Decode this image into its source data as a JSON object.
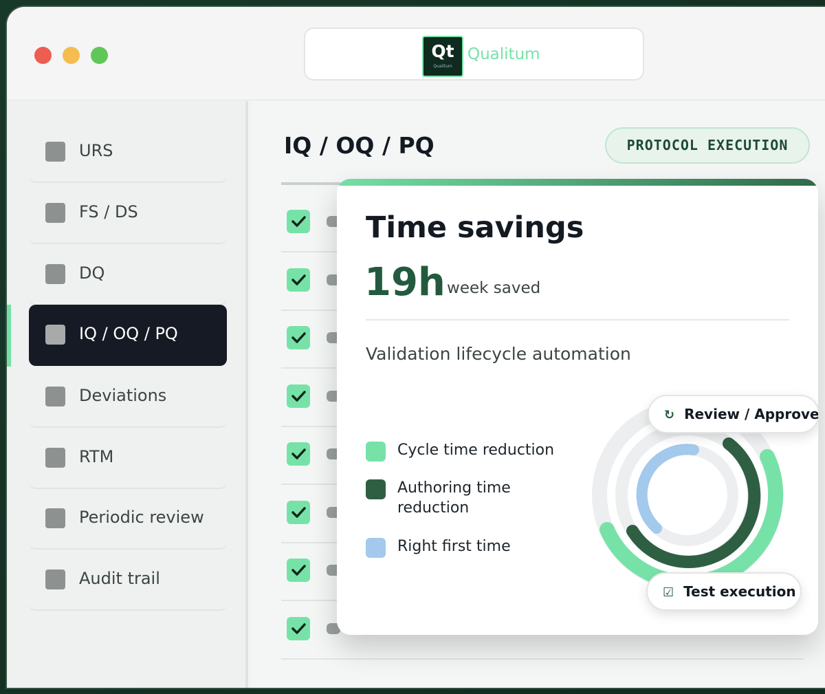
{
  "window": {
    "logo_mark": "Qt",
    "logo_small": "Qualitum",
    "brand_name": "Qualitum"
  },
  "sidebar": {
    "items": [
      {
        "label": "URS"
      },
      {
        "label": "FS / DS"
      },
      {
        "label": "DQ"
      },
      {
        "label": "IQ / OQ / PQ",
        "active": true
      },
      {
        "label": "Deviations"
      },
      {
        "label": "RTM"
      },
      {
        "label": "Periodic review"
      },
      {
        "label": "Audit trail"
      }
    ]
  },
  "main": {
    "title": "IQ / OQ / PQ",
    "badge": "PROTOCOL EXECUTION",
    "checked_rows": 8
  },
  "card": {
    "title": "Time savings",
    "value": "19h",
    "value_suffix": "/ week saved",
    "subtitle": "Validation lifecycle automation",
    "legend": [
      {
        "label": "Cycle time reduction",
        "color": "#77e2a8"
      },
      {
        "label": "Authoring time reduction",
        "color": "#2f5f43"
      },
      {
        "label": "Right first time",
        "color": "#a3c9ec"
      }
    ],
    "review_pill": "Review / Approve",
    "test_pill": "Test execution"
  },
  "colors": {
    "accent": "#77e2a8",
    "dark_green": "#235a3d",
    "navy": "#161a24"
  }
}
